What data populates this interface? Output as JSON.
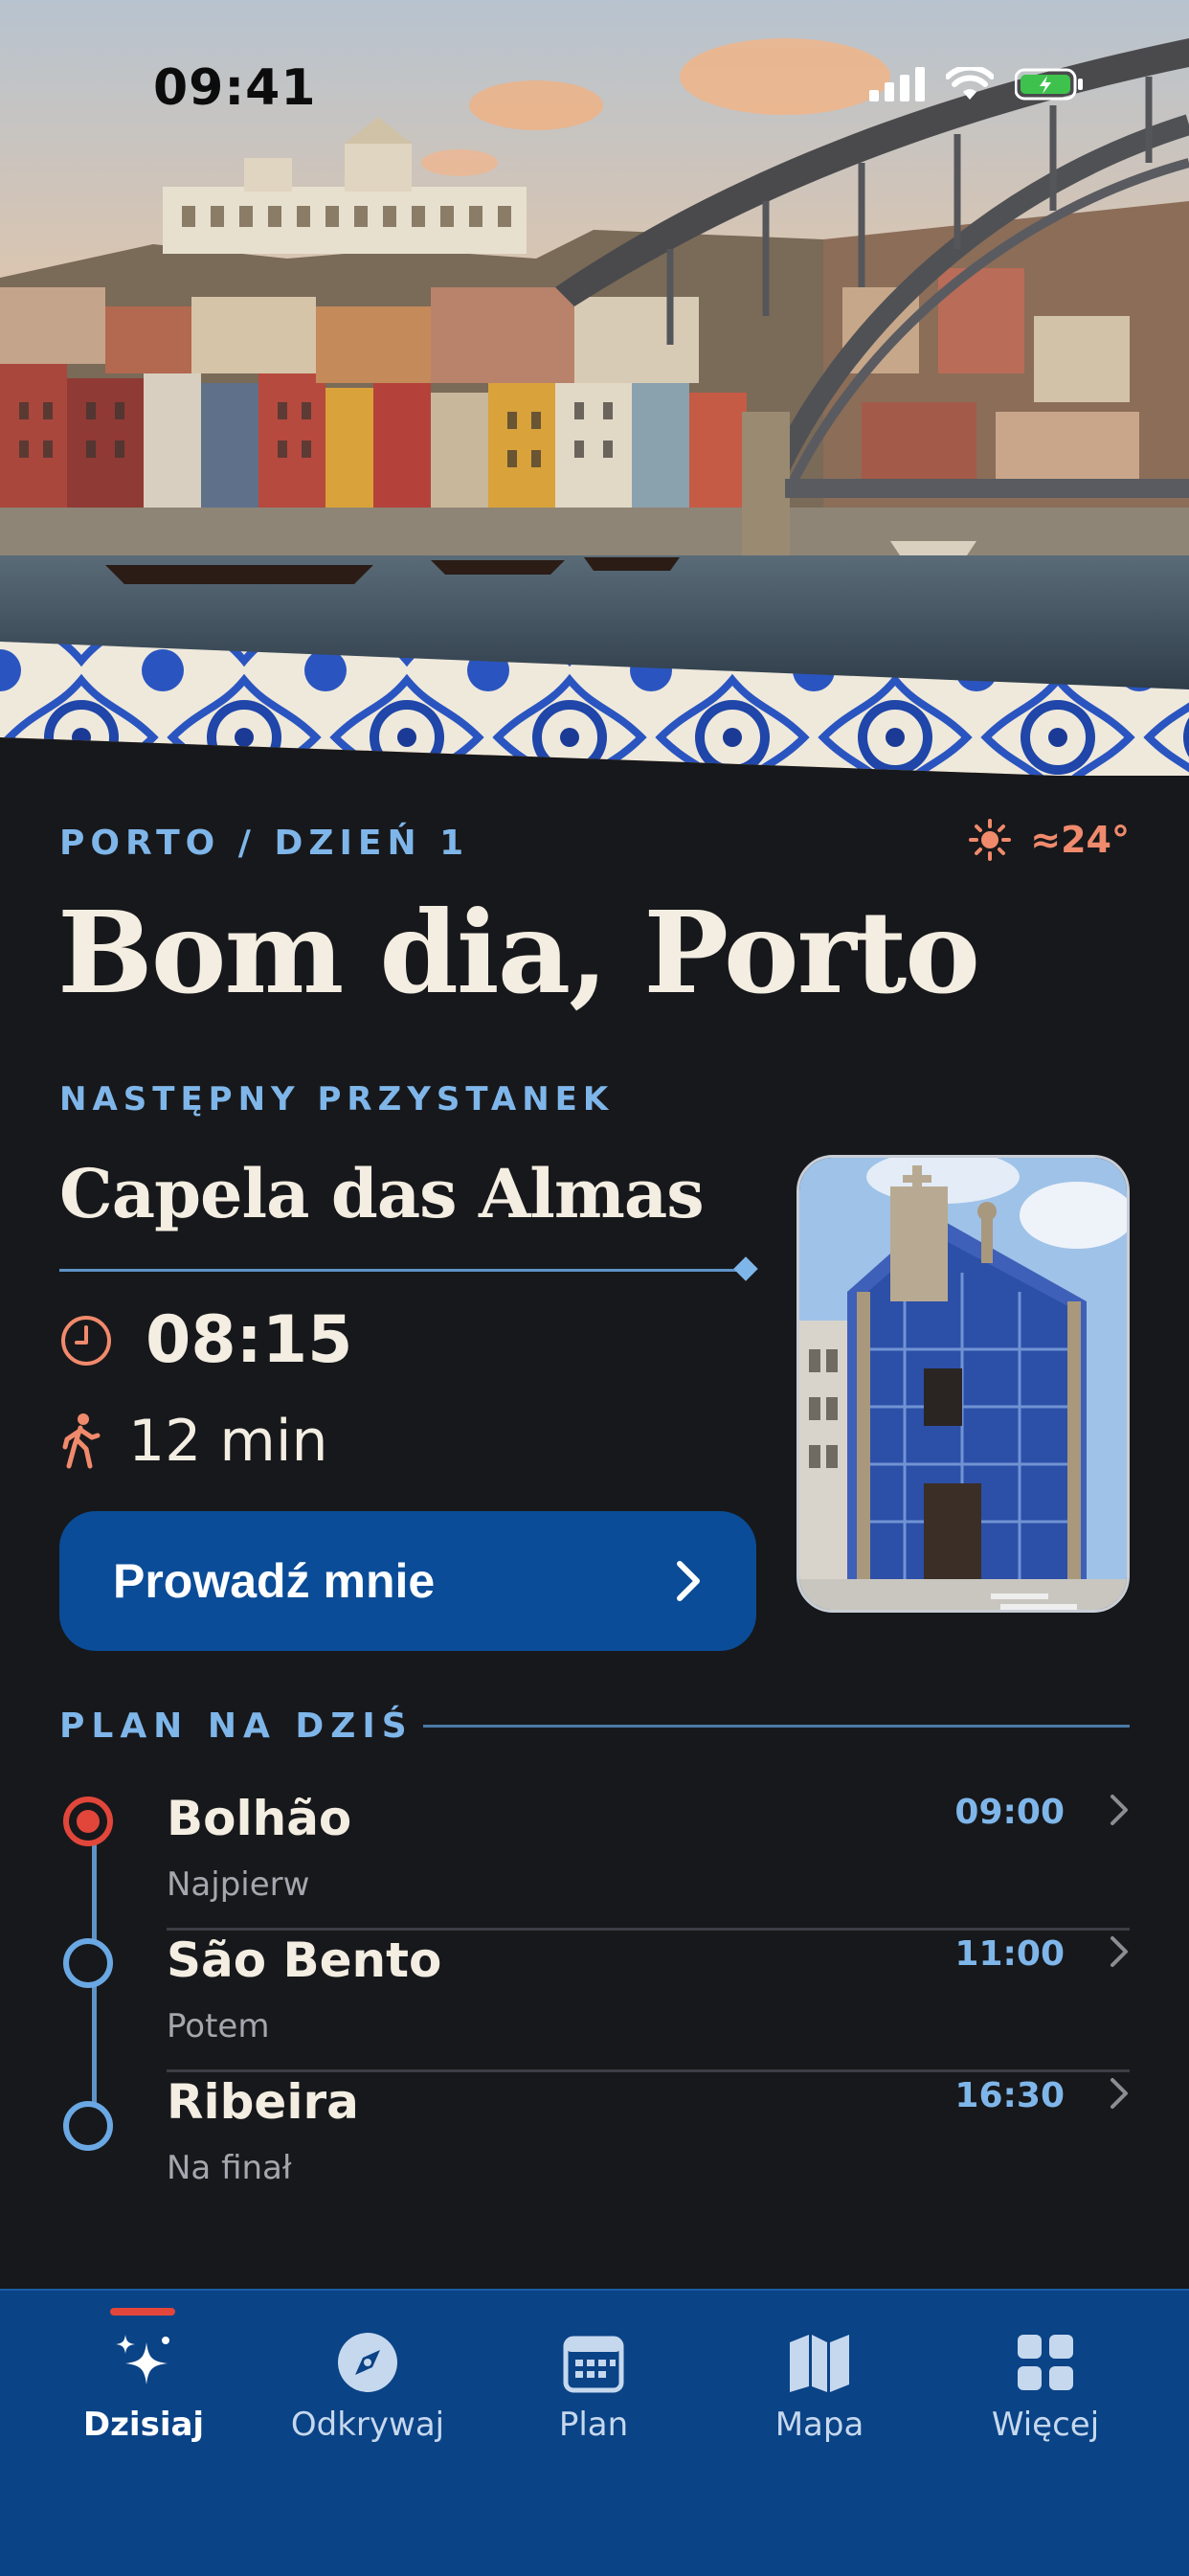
{
  "status_bar": {
    "time": "09:41"
  },
  "hero": {
    "image": "Porto riverside skyline with Dom Luís I bridge and azulejo tile border"
  },
  "header": {
    "eyebrow": "PORTO / DZIEŃ 1",
    "weather": {
      "icon": "sun-icon",
      "temperature": "≈24°"
    },
    "greeting": "Bom dia, Porto"
  },
  "next_stop": {
    "label": "NASTĘPNY PRZYSTANEK",
    "title": "Capela das Almas",
    "time": "08:15",
    "walk": "12 min",
    "button_label": "Prowadź mnie",
    "photo": "Capela das Almas blue azulejo facade"
  },
  "plan": {
    "label": "PLAN NA DZIŚ",
    "stops": [
      {
        "name": "Bolhão",
        "sub": "Najpierw",
        "time": "09:00",
        "active": true
      },
      {
        "name": "São Bento",
        "sub": "Potem",
        "time": "11:00",
        "active": false
      },
      {
        "name": "Ribeira",
        "sub": "Na finał",
        "time": "16:30",
        "active": false
      }
    ]
  },
  "tabs": [
    {
      "label": "Dzisiaj",
      "icon": "sparkles-icon",
      "active": true
    },
    {
      "label": "Odkrywaj",
      "icon": "compass-icon",
      "active": false
    },
    {
      "label": "Plan",
      "icon": "calendar-icon",
      "active": false
    },
    {
      "label": "Mapa",
      "icon": "map-icon",
      "active": false
    },
    {
      "label": "Więcej",
      "icon": "grid-icon",
      "active": false
    }
  ],
  "colors": {
    "accent": "#7fb6ea",
    "primary_button": "#0a4c97",
    "tabbar": "#0a4386",
    "alert": "#e2463b",
    "warm": "#f08a6c",
    "background": "#17181b"
  }
}
